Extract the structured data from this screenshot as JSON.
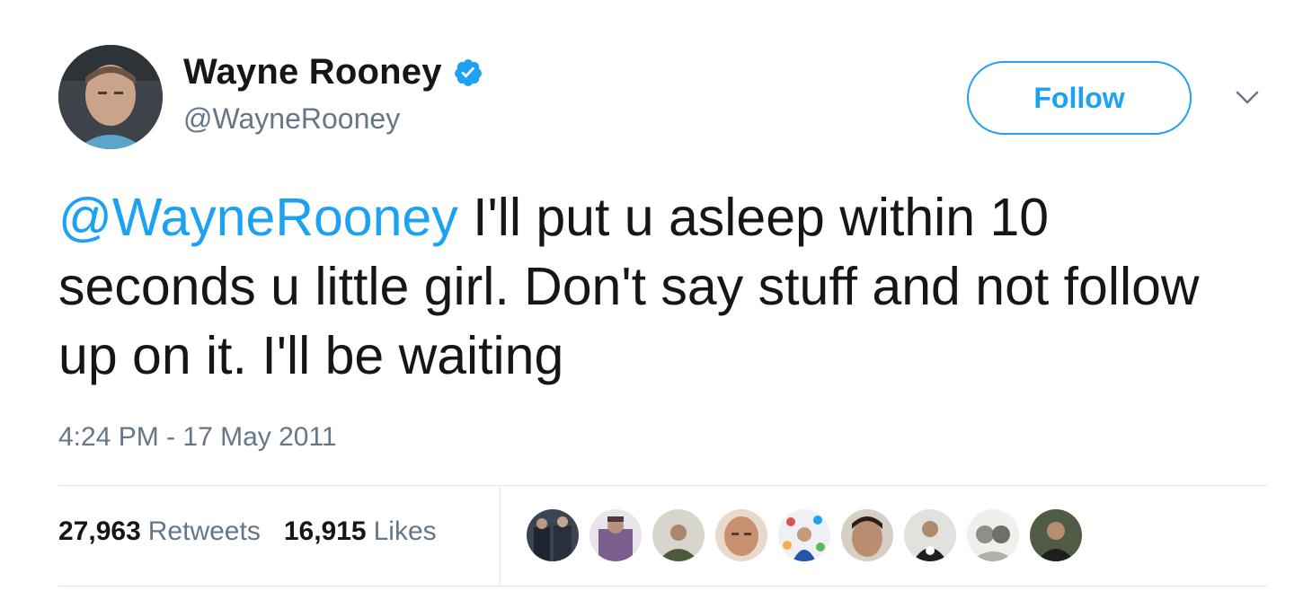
{
  "tweet": {
    "author": {
      "display_name": "Wayne Rooney",
      "handle": "@WayneRooney",
      "verified": true,
      "verified_color": "#1da1f2"
    },
    "follow_label": "Follow",
    "text_mention": "@WayneRooney",
    "text_body": " I'll put u asleep within 10 seconds u little girl. Don't say stuff and not follow up on it. I'll be waiting",
    "timestamp": "4:24 PM - 17 May 2011",
    "retweets": {
      "count": "27,963",
      "label": "Retweets"
    },
    "likes": {
      "count": "16,915",
      "label": "Likes"
    },
    "liker_avatar_count": 9
  },
  "colors": {
    "accent": "#1da1f2",
    "text_primary": "#14171a",
    "text_secondary": "#657786",
    "divider": "#e1e8ed"
  },
  "icons": {
    "verified": "verified-badge-icon",
    "caret": "chevron-down-icon"
  }
}
